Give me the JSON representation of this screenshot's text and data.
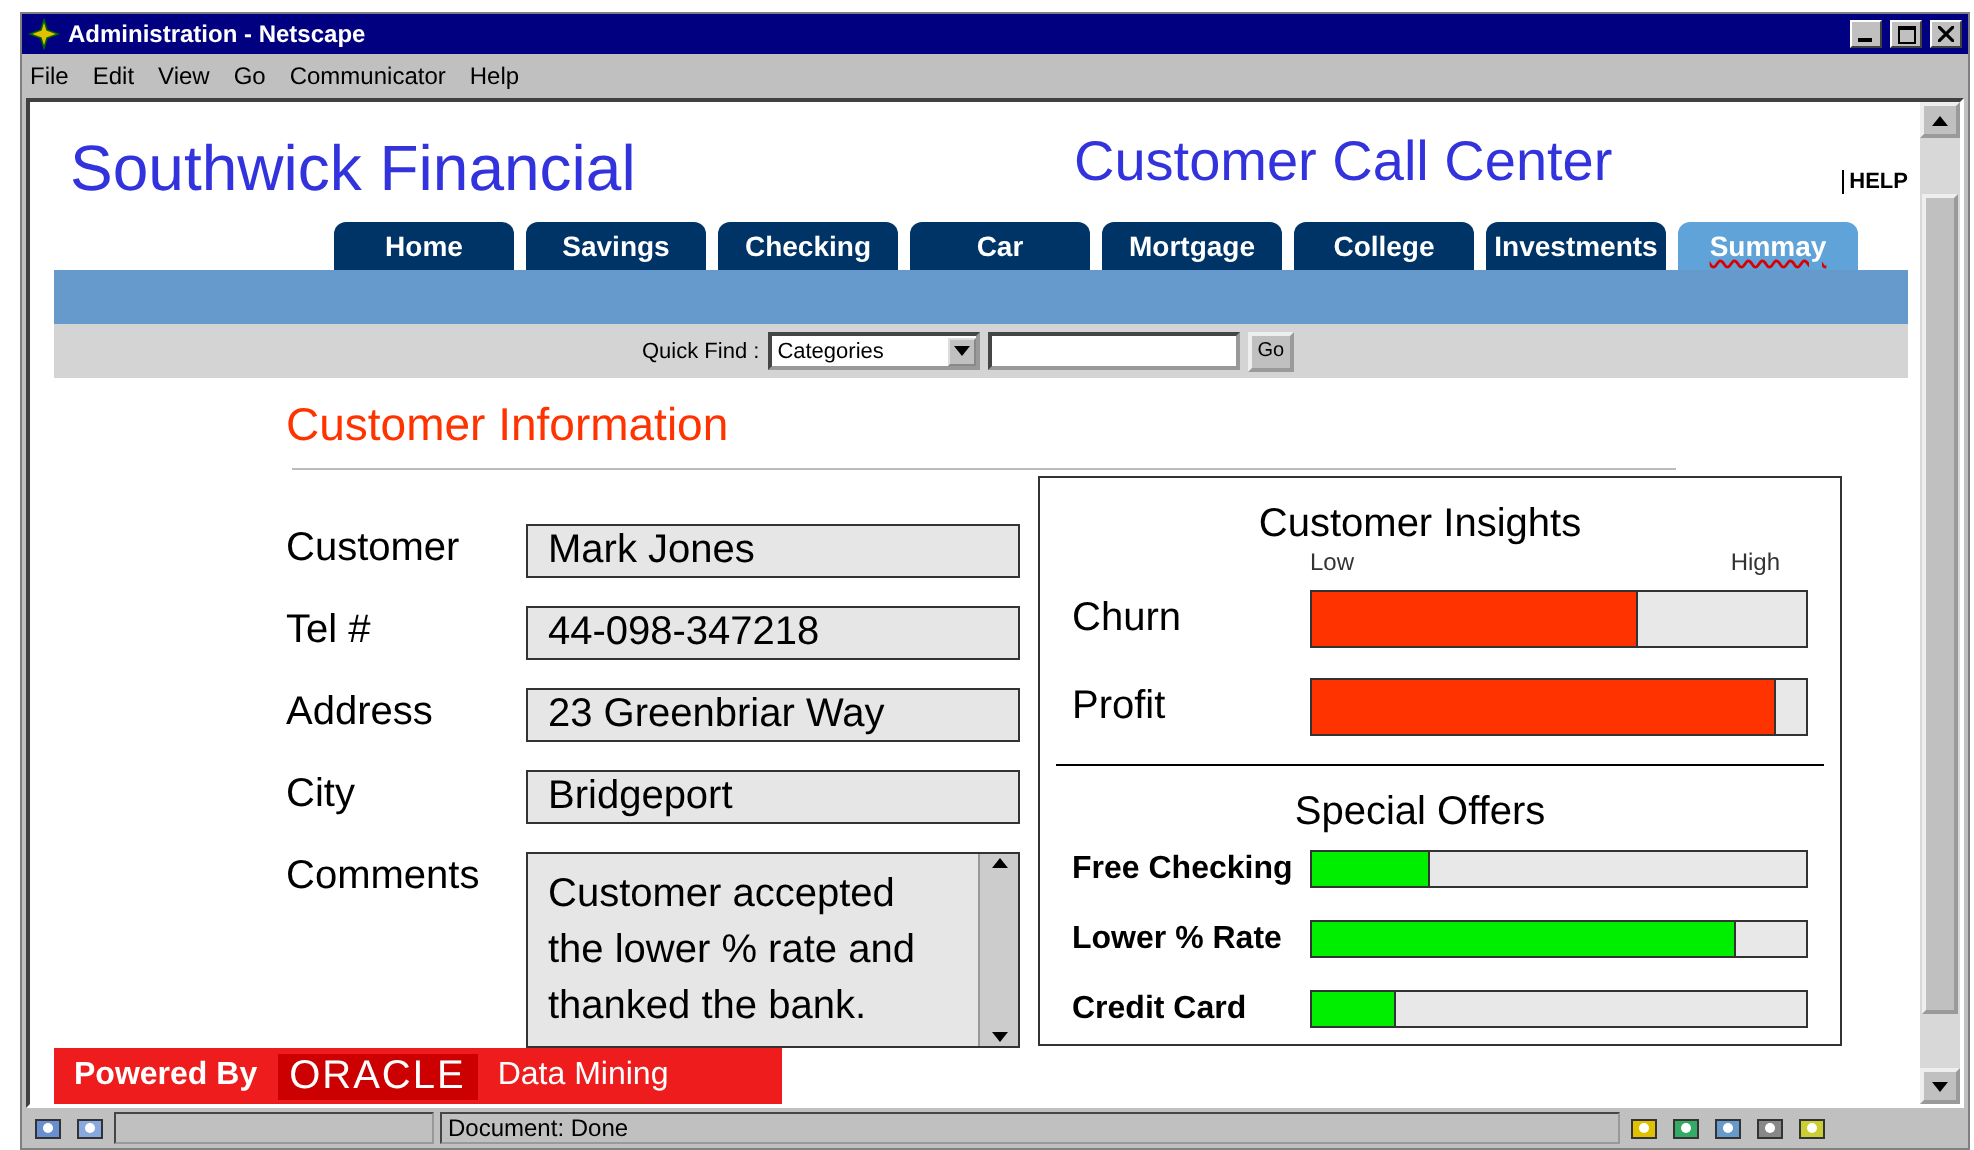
{
  "window": {
    "title": "Administration - Netscape",
    "menu": [
      "File",
      "Edit",
      "View",
      "Go",
      "Communicator",
      "Help"
    ]
  },
  "header": {
    "brand": "Southwick Financial",
    "subtitle": "Customer Call Center",
    "help": "HELP"
  },
  "tabs": [
    {
      "label": "Home",
      "selected": false
    },
    {
      "label": "Savings",
      "selected": false
    },
    {
      "label": "Checking",
      "selected": false
    },
    {
      "label": "Car",
      "selected": false
    },
    {
      "label": "Mortgage",
      "selected": false
    },
    {
      "label": "College",
      "selected": false
    },
    {
      "label": "Investments",
      "selected": false
    },
    {
      "label": "Summay",
      "selected": true
    }
  ],
  "quick_find": {
    "label": "Quick Find :",
    "select_value": "Categories",
    "go": "Go"
  },
  "customer_info": {
    "heading": "Customer Information",
    "fields": [
      {
        "label": "Customer",
        "value": "Mark Jones",
        "kind": "text"
      },
      {
        "label": "Tel #",
        "value": "44-098-347218",
        "kind": "text"
      },
      {
        "label": "Address",
        "value": "23 Greenbriar Way",
        "kind": "text"
      },
      {
        "label": "City",
        "value": "Bridgeport",
        "kind": "text"
      },
      {
        "label": "Comments",
        "value": "Customer accepted the lower % rate and thanked the bank.",
        "kind": "textarea"
      }
    ]
  },
  "insights": {
    "title": "Customer Insights",
    "scale_low": "Low",
    "scale_high": "High",
    "metrics": [
      {
        "label": "Churn",
        "level": 0.66
      },
      {
        "label": "Profit",
        "level": 0.94
      }
    ],
    "offers_title": "Special Offers",
    "offers": [
      {
        "label": "Free Checking",
        "level": 0.24
      },
      {
        "label": "Lower % Rate",
        "level": 0.86
      },
      {
        "label": "Credit Card",
        "level": 0.17
      }
    ]
  },
  "footer": {
    "powered_by": "Powered By",
    "brand": "ORACLE",
    "product": "Data Mining"
  },
  "status_bar": {
    "text": "Document: Done"
  }
}
